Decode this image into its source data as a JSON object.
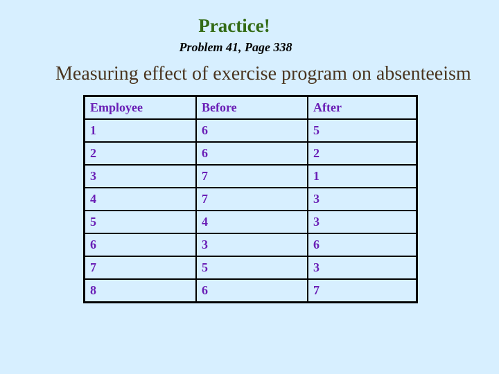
{
  "slide": {
    "title": "Practice!",
    "subtitle": "Problem 41, Page 338",
    "heading": "Measuring effect of exercise program on absenteeism"
  },
  "table": {
    "headers": [
      "Employee",
      "Before",
      "After"
    ],
    "rows": [
      [
        "1",
        "6",
        "5"
      ],
      [
        "2",
        "6",
        "2"
      ],
      [
        "3",
        "7",
        "1"
      ],
      [
        "4",
        "7",
        "3"
      ],
      [
        "5",
        "4",
        "3"
      ],
      [
        "6",
        "3",
        "6"
      ],
      [
        "7",
        "5",
        "3"
      ],
      [
        "8",
        "6",
        "7"
      ]
    ]
  }
}
